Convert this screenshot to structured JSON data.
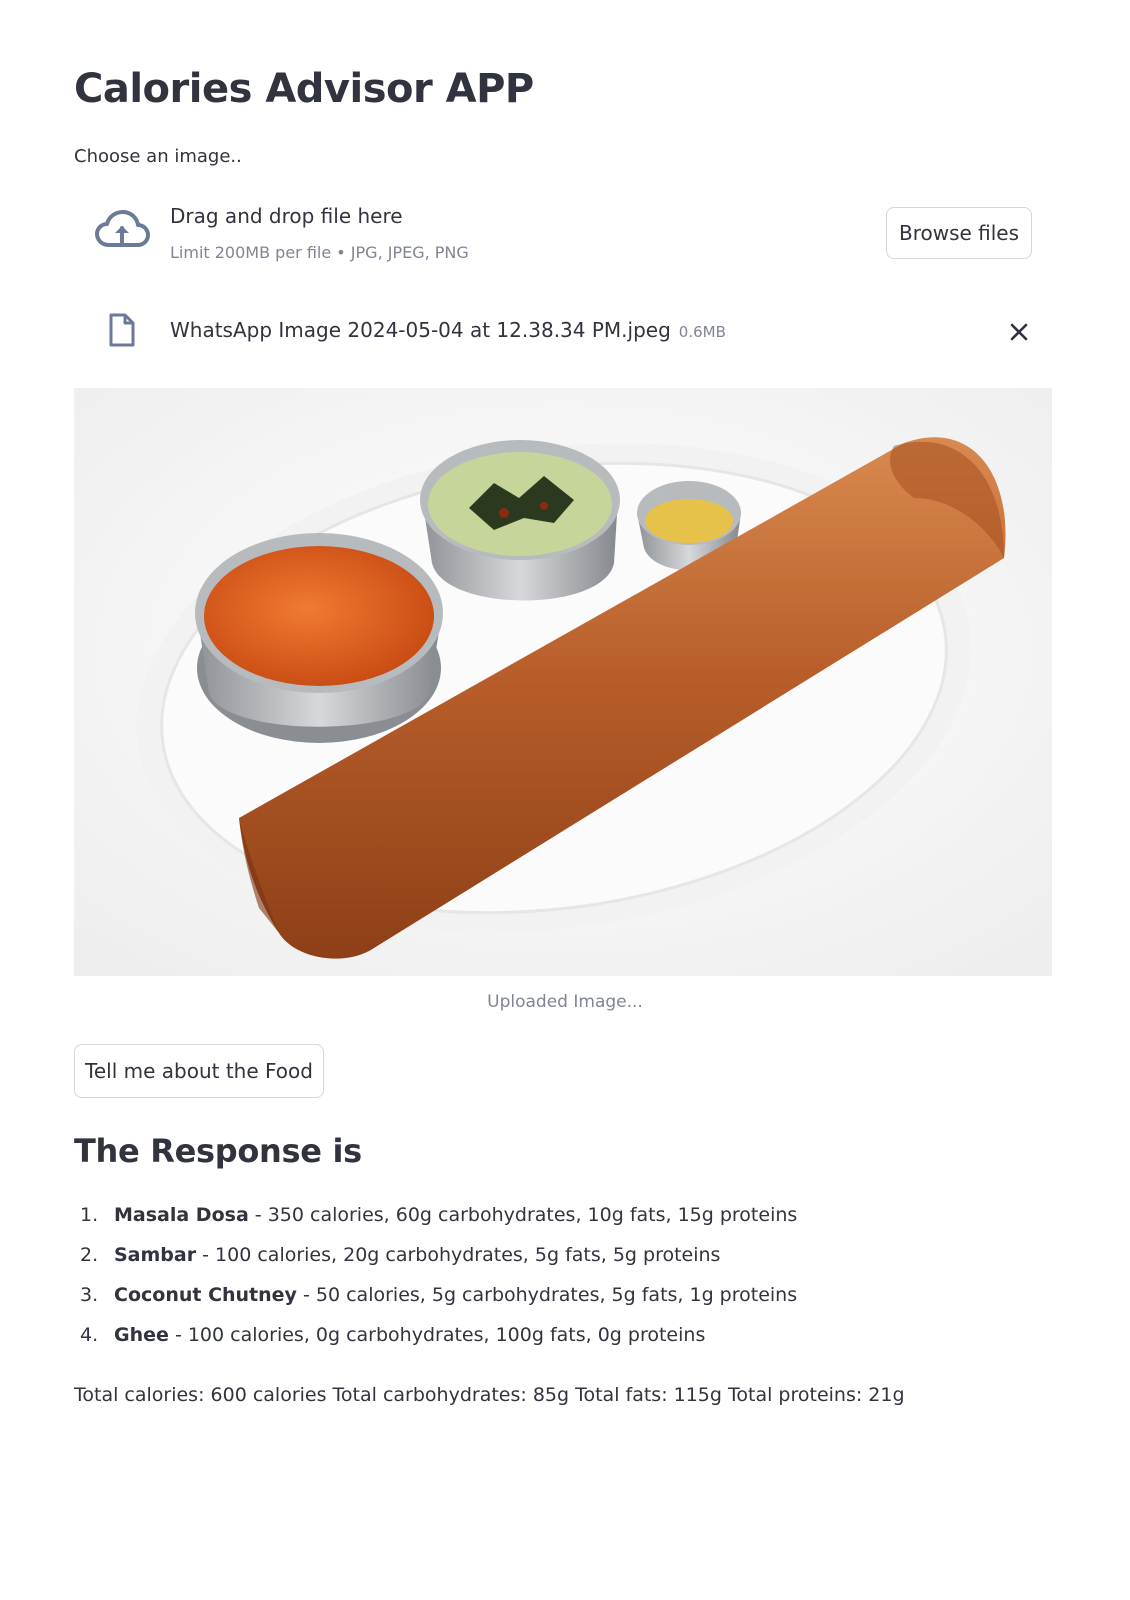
{
  "app": {
    "title": "Calories Advisor APP"
  },
  "uploader": {
    "label": "Choose an image..",
    "drop_title": "Drag and drop file here",
    "limit_text": "Limit 200MB per file • JPG, JPEG, PNG",
    "browse_label": "Browse files",
    "icon": "cloud-upload-icon"
  },
  "uploaded_file": {
    "name": "WhatsApp Image 2024-05-04 at 12.38.34 PM.jpeg",
    "size": "0.6MB",
    "icon": "file-icon",
    "remove_icon": "close-icon"
  },
  "image": {
    "caption": "Uploaded Image..."
  },
  "action": {
    "button_label": "Tell me about the Food"
  },
  "response": {
    "heading": "The Response is",
    "items": [
      {
        "num": "1.",
        "name": "Masala Dosa",
        "details": " - 350 calories, 60g carbohydrates, 10g fats, 15g proteins"
      },
      {
        "num": "2.",
        "name": "Sambar",
        "details": " - 100 calories, 20g carbohydrates, 5g fats, 5g proteins"
      },
      {
        "num": "3.",
        "name": "Coconut Chutney",
        "details": " - 50 calories, 5g carbohydrates, 5g fats, 1g proteins"
      },
      {
        "num": "4.",
        "name": "Ghee",
        "details": " - 100 calories, 0g carbohydrates, 100g fats, 0g proteins"
      }
    ],
    "totals": "Total calories: 600 calories Total carbohydrates: 85g Total fats: 115g Total proteins: 21g"
  },
  "colors": {
    "text": "#31333f",
    "muted": "#808495",
    "border": "#d6d6d9",
    "icon": "#6c7a99"
  }
}
